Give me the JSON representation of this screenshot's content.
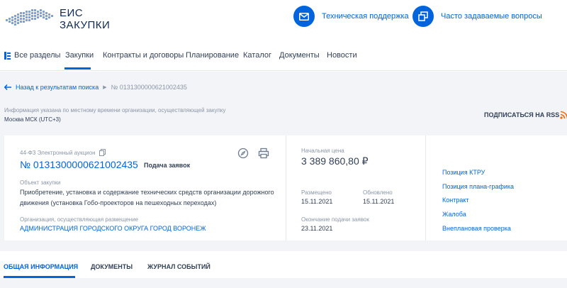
{
  "header": {
    "logo_line1": "ЕИС",
    "logo_line2": "ЗАКУПКИ",
    "support_label": "Техническая поддержка",
    "faq_label": "Часто задаваемые вопросы",
    "support_icon": "mail-icon",
    "faq_icon": "windows-icon"
  },
  "nav": {
    "items": [
      "Все разделы",
      "Закупки",
      "Контракты и договоры",
      "Планирование",
      "Каталог",
      "Документы",
      "Новости"
    ],
    "active": "Закупки"
  },
  "breadcrumb": {
    "back_label": "Назад к результатам поиска",
    "current": "№ 0131300000621002435"
  },
  "notice": {
    "text": "Информация указана по местному времени организации, осуществляющей закупку",
    "timezone": "Москва МСК (UTC+3)"
  },
  "rss": {
    "label": "ПОДПИСАТЬСЯ НА RSS"
  },
  "card": {
    "law_type": "44-ФЗ Электронный аукцион",
    "reg_number": "№ 0131300000621002435",
    "status": "Подача заявок",
    "subject_label": "Объект закупки",
    "subject": "Приобретение, установка и содержание технических средств организации дорожного движения (установка Гобо-проекторов на пешеходных переходах)",
    "org_label": "Организация, осуществляющая размещение",
    "org": "АДМИНИСТРАЦИЯ ГОРОДСКОГО ОКРУГА ГОРОД ВОРОНЕЖ",
    "price_label": "Начальная цена",
    "price": "3 389 860,80 ₽",
    "placed_label": "Размещено",
    "placed": "15.11.2021",
    "updated_label": "Обновлено",
    "updated": "15.11.2021",
    "end_label": "Окончание подачи заявок",
    "end": "23.11.2021",
    "links": [
      "Позиция КТРУ",
      "Позиция плана-графика",
      "Контракт",
      "Жалоба",
      "Внеплановая проверка"
    ]
  },
  "tabs": {
    "items": [
      "ОБЩАЯ ИНФОРМАЦИЯ",
      "ДОКУМЕНТЫ",
      "ЖУРНАЛ СОБЫТИЙ"
    ],
    "active": "ОБЩАЯ ИНФОРМАЦИЯ"
  },
  "colors": {
    "accent": "#0065dd",
    "text": "#334059",
    "muted": "#8a96a8",
    "background": "#f2f4f7",
    "rss": "#ff6600"
  }
}
